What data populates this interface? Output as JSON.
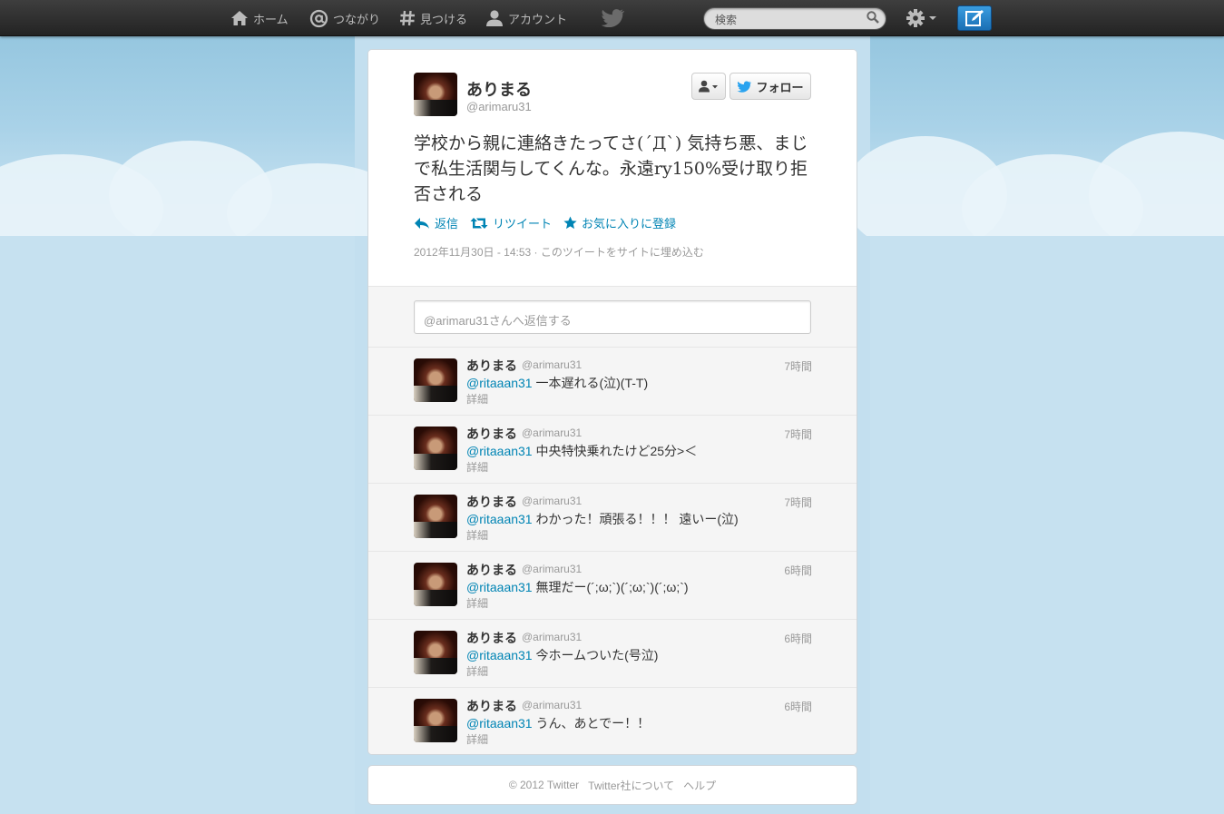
{
  "topnav": {
    "home_label": "ホーム",
    "connect_label": "つながり",
    "discover_label": "見つける",
    "account_label": "アカウント",
    "search_placeholder": "検索"
  },
  "main_tweet": {
    "name": "ありまる",
    "handle": "@arimaru31",
    "follow_label": "フォロー",
    "text": "学校から親に連絡きたってさ(´Д`) 気持ち悪、まじで私生活関与してくんな。永遠ry150%受け取り拒否される",
    "reply_label": "返信",
    "retweet_label": "リツイート",
    "favorite_label": "お気に入りに登録",
    "timestamp": "2012年11月30日 - 14:53",
    "embed_label": "このツイートをサイトに埋め込む"
  },
  "reply_box": {
    "placeholder": "@arimaru31さんへ返信する"
  },
  "replies": [
    {
      "name": "ありまる",
      "handle": "@arimaru31",
      "time": "7時間",
      "mention": "@ritaaan31",
      "text": " 一本遅れる(泣)(T-T)",
      "detail": "詳細"
    },
    {
      "name": "ありまる",
      "handle": "@arimaru31",
      "time": "7時間",
      "mention": "@ritaaan31",
      "text": " 中央特快乗れたけど25分>＜",
      "detail": "詳細"
    },
    {
      "name": "ありまる",
      "handle": "@arimaru31",
      "time": "7時間",
      "mention": "@ritaaan31",
      "text": " わかった！頑張る！！！ 遠いー(泣)",
      "detail": "詳細"
    },
    {
      "name": "ありまる",
      "handle": "@arimaru31",
      "time": "6時間",
      "mention": "@ritaaan31",
      "text": " 無理だー(´;ω;`)(´;ω;`)(´;ω;`)",
      "detail": "詳細"
    },
    {
      "name": "ありまる",
      "handle": "@arimaru31",
      "time": "6時間",
      "mention": "@ritaaan31",
      "text": " 今ホームついた(号泣)",
      "detail": "詳細"
    },
    {
      "name": "ありまる",
      "handle": "@arimaru31",
      "time": "6時間",
      "mention": "@ritaaan31",
      "text": " うん、あとでー！！",
      "detail": "詳細"
    }
  ],
  "footer": {
    "copyright": "© 2012 Twitter",
    "about": "Twitter社について",
    "help": "ヘルプ"
  },
  "colors": {
    "link": "#0084b4",
    "topbar": "#2d2d2d",
    "compose": "#2b86cf"
  },
  "icons": [
    "home-icon",
    "at-icon",
    "hash-icon",
    "person-icon",
    "bird-icon",
    "search-icon",
    "gear-icon",
    "compose-icon",
    "reply-icon",
    "retweet-icon",
    "star-icon"
  ]
}
